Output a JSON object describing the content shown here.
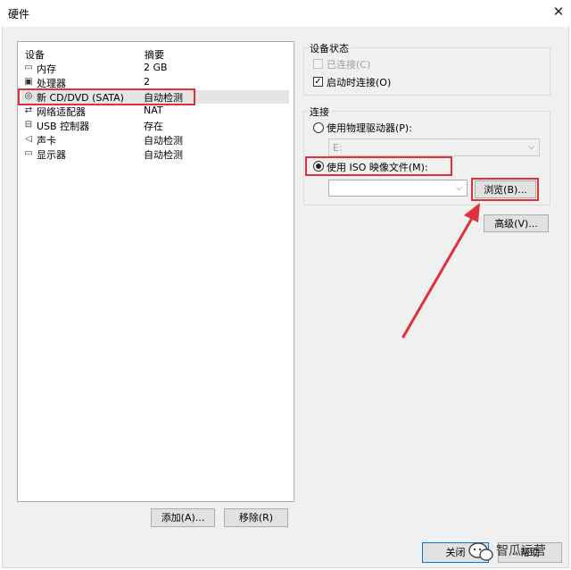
{
  "window": {
    "title": "硬件",
    "close_glyph": "✕"
  },
  "device_list": {
    "headers": {
      "device": "设备",
      "summary": "摘要"
    },
    "items": [
      {
        "icon": "memory-icon",
        "name": "内存",
        "summary": "2 GB"
      },
      {
        "icon": "processor-icon",
        "name": "处理器",
        "summary": "2"
      },
      {
        "icon": "cd-dvd-icon",
        "name": "新 CD/DVD (SATA)",
        "summary": "自动检测"
      },
      {
        "icon": "network-adapter-icon",
        "name": "网络适配器",
        "summary": "NAT"
      },
      {
        "icon": "usb-icon",
        "name": "USB 控制器",
        "summary": "存在"
      },
      {
        "icon": "sound-card-icon",
        "name": "声卡",
        "summary": "自动检测"
      },
      {
        "icon": "display-icon",
        "name": "显示器",
        "summary": "自动检测"
      }
    ],
    "selected_index": 2
  },
  "buttons": {
    "add": "添加(A)...",
    "remove": "移除(R)",
    "browse": "浏览(B)...",
    "advanced": "高级(V)...",
    "close": "关闭",
    "help": "帮助"
  },
  "device_status": {
    "label": "设备状态",
    "connected": {
      "label": "已连接(C)",
      "checked": false,
      "enabled": false
    },
    "connect_on_power_on": {
      "label": "启动时连接(O)",
      "checked": true
    }
  },
  "connection": {
    "label": "连接",
    "physical_drive": {
      "label": "使用物理驱动器(P):",
      "selected": false,
      "drive_value": "E:"
    },
    "iso_image": {
      "label": "使用 ISO 映像文件(M):",
      "selected": true,
      "path_value": ""
    }
  },
  "watermark": {
    "text": "智瓜运营"
  },
  "colors": {
    "highlight": "#e0303a",
    "selection": "#e5e5e5",
    "dialog_bg": "#f0f0f0"
  }
}
